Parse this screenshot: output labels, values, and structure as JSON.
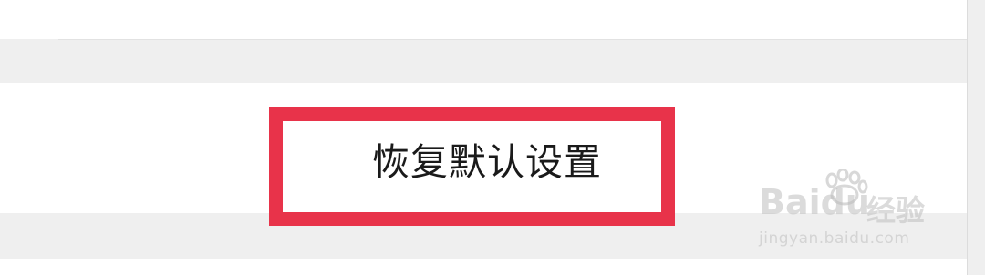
{
  "settings": {
    "reset_button_label": "恢复默认设置"
  },
  "watermark": {
    "brand": "Baidu",
    "suffix": "经验",
    "url": "jingyan.baidu.com"
  },
  "colors": {
    "highlight_border": "#e8334a",
    "section_gray": "#efefef",
    "text": "#1a1a1a"
  }
}
